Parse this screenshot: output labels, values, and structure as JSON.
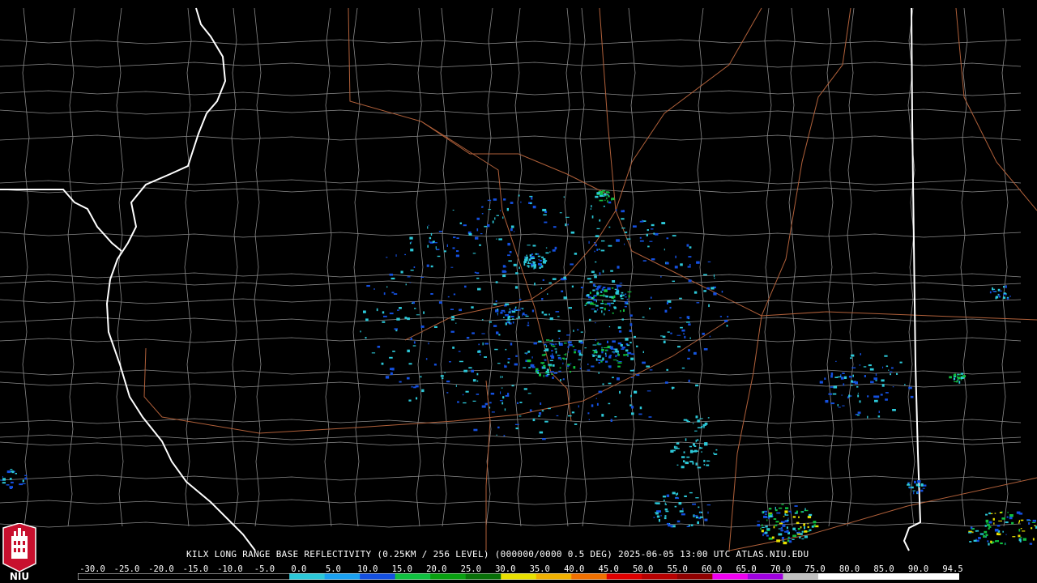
{
  "title": "KILX LONG RANGE BASE REFLECTIVITY (0.25KM / 256 LEVEL) (000000/0000 0.5 DEG) 2025-06-05 13:00 UTC  ATLAS.NIU.EDU",
  "logo_text": "NIU",
  "scale": {
    "ticks": [
      "-30.0",
      "-25.0",
      "-20.0",
      "-15.0",
      "-10.0",
      "-5.0",
      "0.0",
      "5.0",
      "10.0",
      "15.0",
      "20.0",
      "25.0",
      "30.0",
      "35.0",
      "40.0",
      "45.0",
      "50.0",
      "55.0",
      "60.0",
      "65.0",
      "70.0",
      "75.0",
      "80.0",
      "85.0",
      "90.0",
      "94.5"
    ],
    "colors": [
      "#000000",
      "#000000",
      "#000000",
      "#000000",
      "#000000",
      "#000000",
      "#2cc8d8",
      "#1aa0f0",
      "#1450e0",
      "#10c040",
      "#08a010",
      "#087008",
      "#e8e000",
      "#f0b000",
      "#f07000",
      "#e00000",
      "#b80000",
      "#900000",
      "#f000f0",
      "#a000e0",
      "#c0c0c0",
      "#ffffff",
      "#ffffff",
      "#ffffff",
      "#ffffff"
    ]
  },
  "colors": {
    "county": "#8a8a8a",
    "state": "#ffffff",
    "highway": "#b0603a",
    "echo_low": "#2cc8d8",
    "echo_mid": "#1450e0",
    "echo_high": "#10c040",
    "echo_peak": "#e8e000"
  }
}
